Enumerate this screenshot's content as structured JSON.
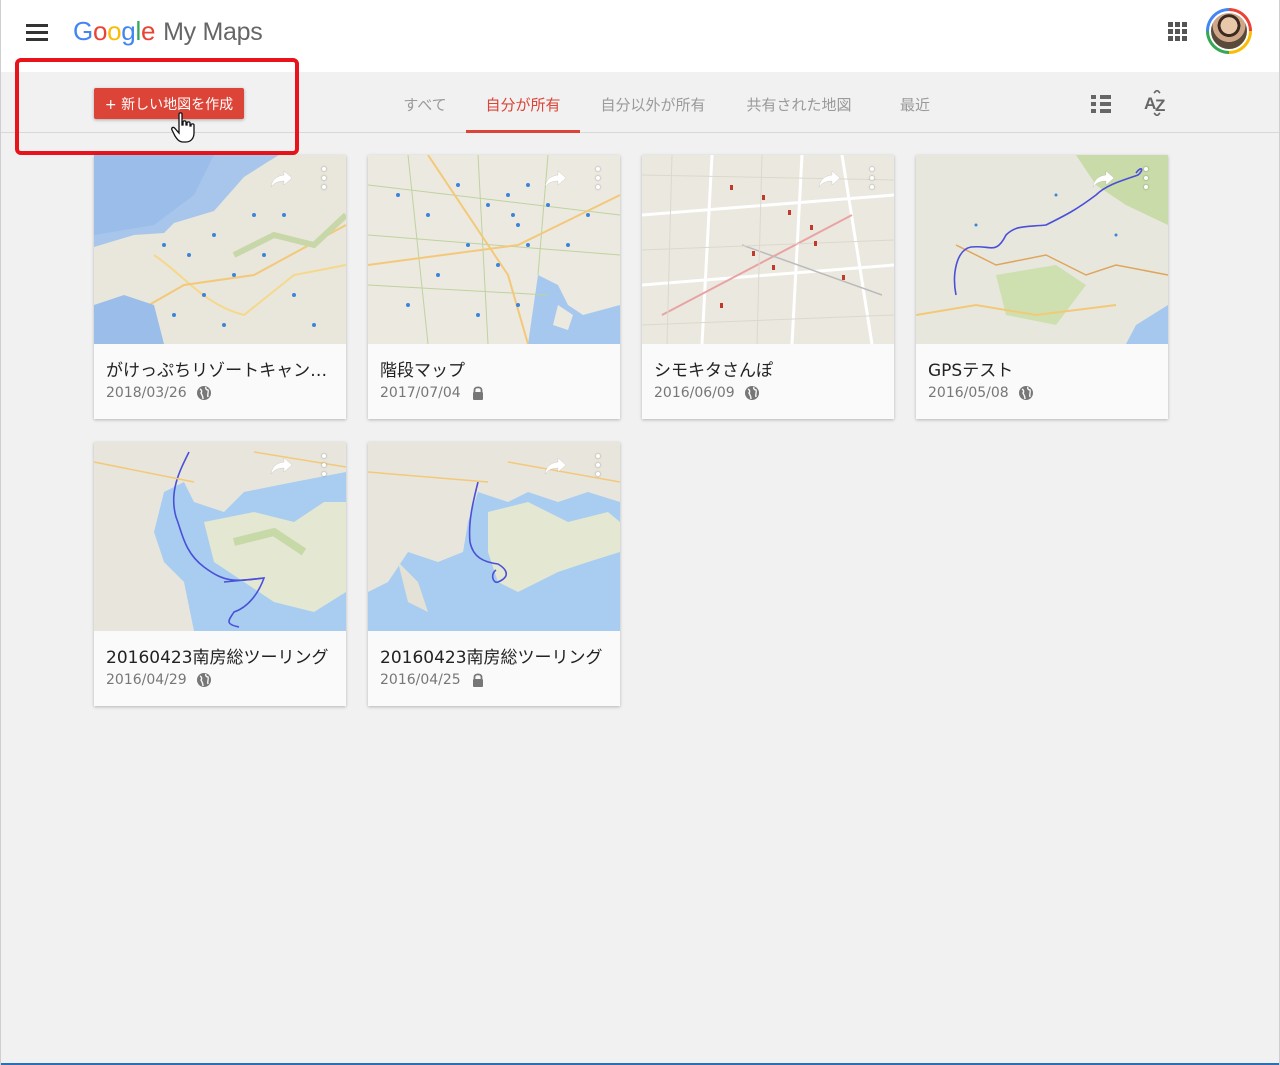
{
  "header": {
    "logo_google": [
      "G",
      "o",
      "o",
      "g",
      "l",
      "e"
    ],
    "logo_product": "My Maps"
  },
  "toolbar": {
    "new_map_label": "+ 新しい地図を作成"
  },
  "tabs": [
    {
      "label": "すべて",
      "active": false
    },
    {
      "label": "自分が所有",
      "active": true
    },
    {
      "label": "自分以外が所有",
      "active": false
    },
    {
      "label": "共有された地図",
      "active": false
    },
    {
      "label": "最近",
      "active": false
    }
  ],
  "colors": {
    "accent": "#db4437",
    "highlight": "#e8131b"
  },
  "maps": [
    {
      "title": "がけっぷちリゾートキャン…",
      "date": "2018/03/26",
      "visibility": "globe-icon",
      "thumb": "coast"
    },
    {
      "title": "階段マップ",
      "date": "2017/07/04",
      "visibility": "lock-icon",
      "thumb": "city"
    },
    {
      "title": "シモキタさんぽ",
      "date": "2016/06/09",
      "visibility": "globe-icon",
      "thumb": "streets"
    },
    {
      "title": "GPSテスト",
      "date": "2016/05/08",
      "visibility": "globe-icon",
      "thumb": "route"
    },
    {
      "title": "20160423南房総ツーリング",
      "date": "2016/04/29",
      "visibility": "globe-icon",
      "thumb": "bay1"
    },
    {
      "title": "20160423南房総ツーリング",
      "date": "2016/04/25",
      "visibility": "lock-icon",
      "thumb": "bay2"
    }
  ]
}
